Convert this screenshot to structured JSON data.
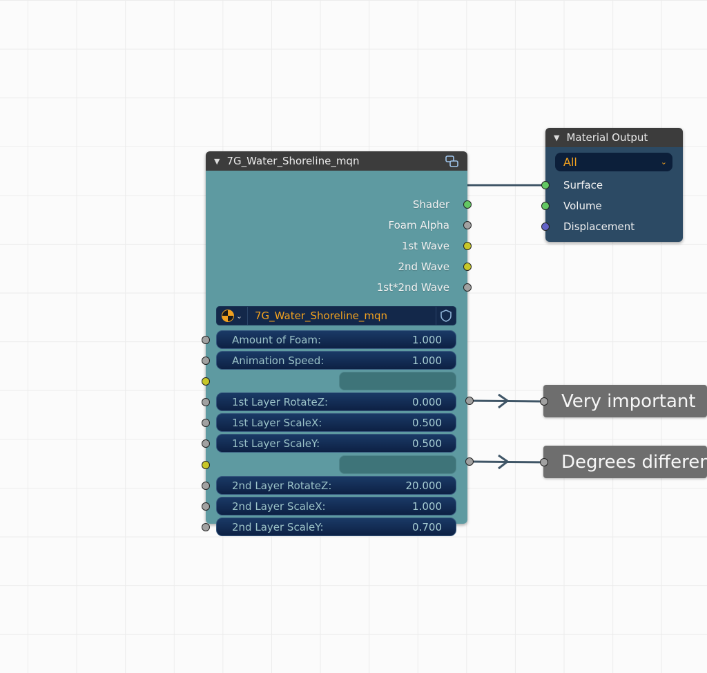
{
  "group_node": {
    "title": "7G_Water_Shoreline_mqn",
    "outputs": [
      "Shader",
      "Foam Alpha",
      "1st Wave",
      "2nd Wave",
      "1st*2nd Wave"
    ],
    "datablock_name": "7G_Water_Shoreline_mqn",
    "fields": [
      {
        "label": "Amount of Foam:",
        "value": "1.000"
      },
      {
        "label": "Animation Speed:",
        "value": "1.000"
      },
      {
        "label": "1st Layer RotateZ:",
        "value": "0.000"
      },
      {
        "label": "1st Layer ScaleX:",
        "value": "0.500"
      },
      {
        "label": "1st Layer ScaleY:",
        "value": "0.500"
      },
      {
        "label": "2nd Layer RotateZ:",
        "value": "20.000"
      },
      {
        "label": "2nd Layer ScaleX:",
        "value": "1.000"
      },
      {
        "label": "2nd Layer ScaleY:",
        "value": "0.700"
      }
    ]
  },
  "output_node": {
    "title": "Material Output",
    "target": "All",
    "inputs": [
      "Surface",
      "Volume",
      "Displacement"
    ]
  },
  "frames": [
    "Very important",
    "Degrees difference"
  ],
  "colors": {
    "group_body": "#5e9aa1",
    "output_body": "#2c4a64",
    "header": "#3c3c3c",
    "socket_shader": "#63c763",
    "socket_float": "#a1a1a1",
    "socket_color": "#c7c729",
    "socket_vector": "#6363c7",
    "datablock_text": "#f5a31e"
  }
}
